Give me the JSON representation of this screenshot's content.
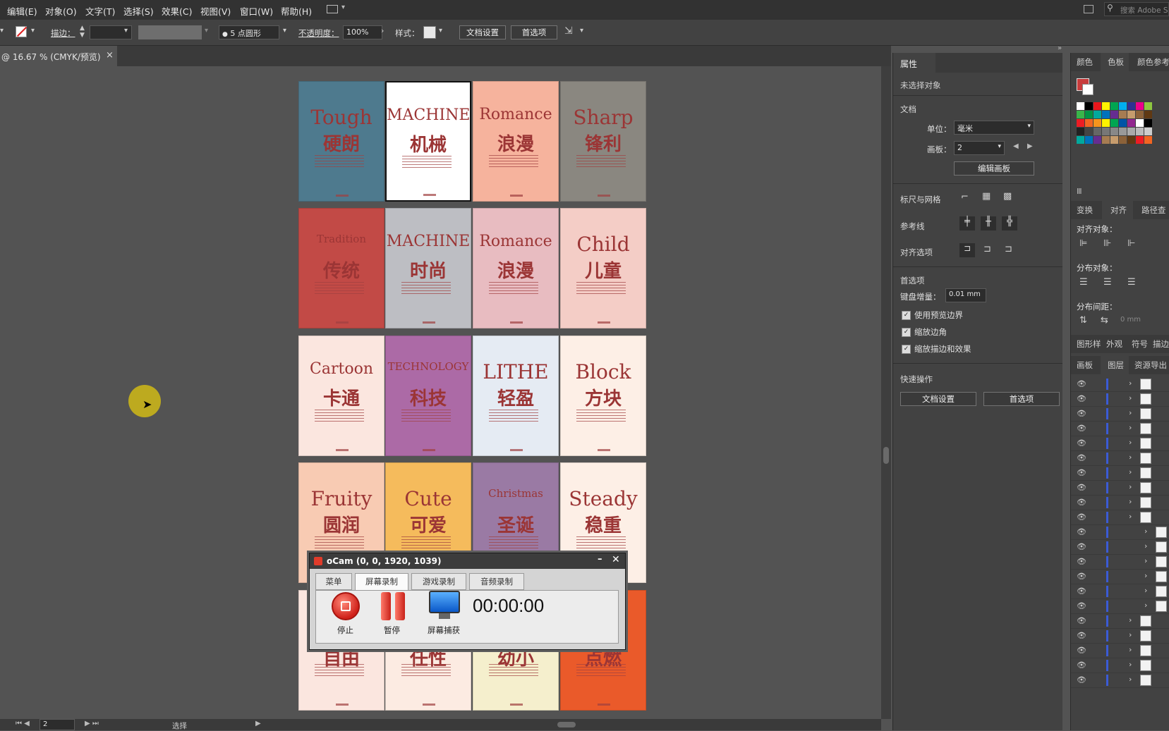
{
  "menubar": {
    "items": [
      "编辑(E)",
      "对象(O)",
      "文字(T)",
      "选择(S)",
      "效果(C)",
      "视图(V)",
      "窗口(W)",
      "帮助(H)"
    ],
    "search_placeholder": "搜索 Adobe S"
  },
  "control_bar": {
    "stroke_label": "描边：",
    "brush_value": "5 点圆形",
    "opacity_label": "不透明度：",
    "opacity_value": "100%",
    "style_label": "样式：",
    "doc_setup_button": "文档设置",
    "preferences_button": "首选项"
  },
  "doc_tab": {
    "title": "@ 16.67 % (CMYK/预览)",
    "close": "×"
  },
  "artboards": [
    {
      "en": "Tough",
      "cn": "硬朗",
      "bg": "#4e7a8e"
    },
    {
      "en": "MACHINE",
      "cn": "机械",
      "bg": "#ffffff"
    },
    {
      "en": "Romance",
      "cn": "浪漫",
      "bg": "#f6b39d"
    },
    {
      "en": "Sharp",
      "cn": "锋利",
      "bg": "#8a8780"
    },
    {
      "en": "Tradition",
      "cn": "传统",
      "bg": "#c24a46"
    },
    {
      "en": "MACHINE",
      "cn": "时尚",
      "bg": "#bdbec3"
    },
    {
      "en": "Romance",
      "cn": "浪漫",
      "bg": "#e8bcc1"
    },
    {
      "en": "Child",
      "cn": "儿童",
      "bg": "#f4cdc6"
    },
    {
      "en": "Cartoon",
      "cn": "卡通",
      "bg": "#fbe6df"
    },
    {
      "en": "TECHNOLOGY",
      "cn": "科技",
      "bg": "#ac6aa6"
    },
    {
      "en": "LITHE",
      "cn": "轻盈",
      "bg": "#e5ebf3"
    },
    {
      "en": "Block",
      "cn": "方块",
      "bg": "#fdefe6"
    },
    {
      "en": "Fruity",
      "cn": "圆润",
      "bg": "#f8cbb3"
    },
    {
      "en": "Cute",
      "cn": "可爱",
      "bg": "#f5bb5c"
    },
    {
      "en": "Christmas",
      "cn": "圣诞",
      "bg": "#9a7aa4"
    },
    {
      "en": "Steady",
      "cn": "稳重",
      "bg": "#fdefe6"
    },
    {
      "en": "",
      "cn": "自由",
      "bg": "#fbe6df"
    },
    {
      "en": "",
      "cn": "任性",
      "bg": "#fcebe2"
    },
    {
      "en": "",
      "cn": "幼小",
      "bg": "#f5efcd"
    },
    {
      "en": "",
      "cn": "点燃",
      "bg": "#ea5a2a"
    }
  ],
  "properties_panel": {
    "tab": "属性",
    "no_selection": "未选择对象",
    "document_section": "文档",
    "unit_label": "单位：",
    "unit_value": "毫米",
    "artboard_label": "画板：",
    "artboard_value": "2",
    "edit_artboards_button": "编辑画板",
    "rulers_grid": "标尺与网格",
    "guides": "参考线",
    "align_options": "对齐选项",
    "preferences_section": "首选项",
    "keyboard_increment_label": "键盘增量：",
    "keyboard_increment_value": "0.01 mm",
    "checkboxes": [
      "使用预览边界",
      "缩放边角",
      "缩放描边和效果"
    ],
    "quick_actions": "快速操作",
    "qa_doc_setup": "文档设置",
    "qa_preferences": "首选项"
  },
  "right_panel": {
    "top_tabs": [
      "颜色",
      "色板",
      "颜色参考"
    ],
    "mid_tabs": [
      "变换",
      "对齐",
      "路径查"
    ],
    "align_objects": "对齐对象：",
    "distribute_objects": "分布对象：",
    "distribute_spacing": "分布间距：",
    "spacing_value": "0 mm",
    "bottom_tabs": [
      "图形样",
      "外观",
      "符号",
      "描边"
    ],
    "layer_tabs": [
      "画板",
      "图层",
      "资源导出"
    ],
    "swatch_colors": [
      "#ffffff",
      "#000000",
      "#e8161b",
      "#fff200",
      "#00a651",
      "#00aeef",
      "#2e3192",
      "#ec008c",
      "#8dc63f",
      "#39b54a",
      "#009444",
      "#00a99d",
      "#0072bc",
      "#662d91",
      "#a67c52",
      "#c69c6d",
      "#8c6239",
      "#603913",
      "#ed1c24",
      "#f26522",
      "#f7941d",
      "#fff200",
      "#00a651",
      "#0054a6",
      "#92278f"
    ]
  },
  "status_bar": {
    "zoom_page": "2",
    "mode": "选择"
  },
  "ocam": {
    "title": "oCam (0, 0, 1920, 1039)",
    "tabs": [
      "菜单",
      "屏幕录制",
      "游戏录制",
      "音频录制"
    ],
    "stop": "停止",
    "pause": "暂停",
    "capture": "屏幕捕获",
    "timer": "00:00:00"
  }
}
